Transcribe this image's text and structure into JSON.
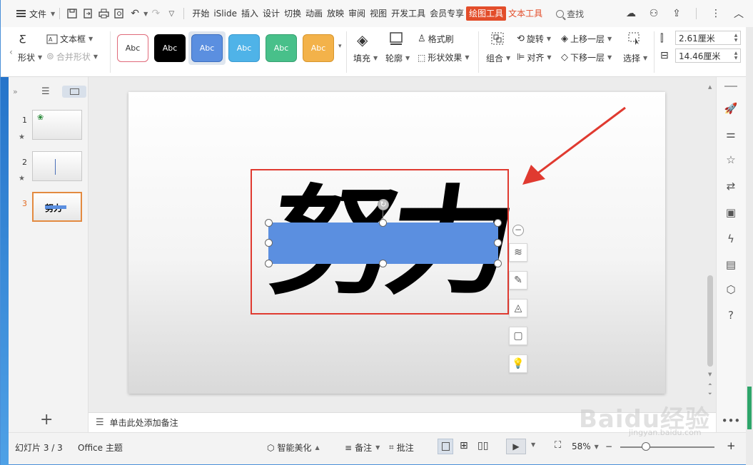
{
  "topbar": {
    "menu_label": "文件",
    "tabs": [
      "开始",
      "iSlide",
      "插入",
      "设计",
      "切换",
      "动画",
      "放映",
      "审阅",
      "视图",
      "开发工具",
      "会员专享",
      "绘图工具",
      "文本工具"
    ],
    "search_label": "查找"
  },
  "ribbon": {
    "shape_label": "形状",
    "textbox_label": "文本框",
    "merge_label": "合并形状",
    "style_boxes": [
      {
        "label": "Abc",
        "bg": "#ffffff",
        "fg": "#333333",
        "border": "#e06a7a"
      },
      {
        "label": "Abc",
        "bg": "#000000",
        "fg": "#ffffff",
        "border": "#000000"
      },
      {
        "label": "Abc",
        "bg": "#5b8fe0",
        "fg": "#ffffff",
        "border": "#3d6fc0"
      },
      {
        "label": "Abc",
        "bg": "#4fb3e8",
        "fg": "#ffffff",
        "border": "#3a9ad0"
      },
      {
        "label": "Abc",
        "bg": "#48c08a",
        "fg": "#ffffff",
        "border": "#36a070"
      },
      {
        "label": "Abc",
        "bg": "#f3b24a",
        "fg": "#ffffff",
        "border": "#d8962c"
      }
    ],
    "fill_label": "填充",
    "outline_label": "轮廓",
    "format_painter_label": "格式刷",
    "shape_effects_label": "形状效果",
    "group_label": "组合",
    "rotate_label": "旋转",
    "align_label": "对齐",
    "bring_forward_label": "上移一层",
    "send_backward_label": "下移一层",
    "select_label": "选择",
    "height_value": "2.61厘米",
    "width_value": "14.46厘米"
  },
  "slides": [
    {
      "num": "1"
    },
    {
      "num": "2"
    },
    {
      "num": "3",
      "thumb_text": "努力"
    }
  ],
  "slide": {
    "big_text": "努力",
    "shape_color": "#5b8fe0"
  },
  "notes_placeholder": "单击此处添加备注",
  "status": {
    "slide_counter": "幻灯片 3 / 3",
    "theme": "Office 主题",
    "beautify": "智能美化",
    "notes": "备注",
    "comments": "批注",
    "zoom": "58%"
  },
  "watermark": {
    "main": "Baidu经验",
    "sub": "jingyan.baidu.com"
  },
  "colors": {
    "accent": "#e34d2a",
    "annotation_red": "#e03a30",
    "selection_blue": "#5b8fe0"
  }
}
